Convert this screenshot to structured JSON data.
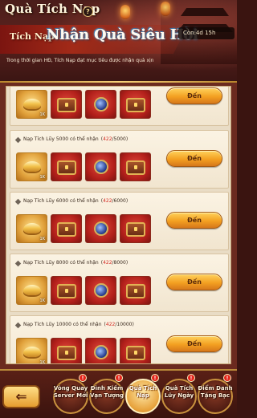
{
  "header": {
    "title": "Quà Tích Nạp",
    "help_icon": "?",
    "banner_sub": "Tích Nạp",
    "banner_main": "Nhận Quà Siêu Hời",
    "countdown": "Còn:4d 15h",
    "description": "Trong thời gian HĐ, Tích Nạp đạt mục tiêu được nhận quà xịn"
  },
  "tiers": [
    {
      "label": "",
      "current": "",
      "target": "",
      "button": "Đến",
      "rewards": [
        {
          "icon": "gold-ingot",
          "qty": "1K"
        },
        {
          "icon": "treasure-chest",
          "qty": ""
        },
        {
          "icon": "blue-orb",
          "qty": ""
        },
        {
          "icon": "treasure-chest",
          "qty": ""
        }
      ]
    },
    {
      "label": "Nạp Tích Lũy 5000 có thể nhận",
      "current": "422",
      "target": "5000",
      "button": "Đến",
      "rewards": [
        {
          "icon": "gold-ingot",
          "qty": "1K"
        },
        {
          "icon": "treasure-chest",
          "qty": ""
        },
        {
          "icon": "blue-orb",
          "qty": ""
        },
        {
          "icon": "treasure-chest",
          "qty": ""
        }
      ]
    },
    {
      "label": "Nạp Tích Lũy 6000 có thể nhận",
      "current": "422",
      "target": "6000",
      "button": "Đến",
      "rewards": [
        {
          "icon": "gold-ingot",
          "qty": "1K"
        },
        {
          "icon": "treasure-chest",
          "qty": ""
        },
        {
          "icon": "blue-orb",
          "qty": ""
        },
        {
          "icon": "treasure-chest",
          "qty": ""
        }
      ]
    },
    {
      "label": "Nạp Tích Lũy 8000 có thể nhận",
      "current": "422",
      "target": "8000",
      "button": "Đến",
      "rewards": [
        {
          "icon": "gold-ingot",
          "qty": "1K"
        },
        {
          "icon": "treasure-chest",
          "qty": ""
        },
        {
          "icon": "blue-orb",
          "qty": ""
        },
        {
          "icon": "treasure-chest",
          "qty": ""
        }
      ]
    },
    {
      "label": "Nạp Tích Lũy 10000 có thể nhận",
      "current": "422",
      "target": "10000",
      "button": "Đến",
      "rewards": [
        {
          "icon": "gold-ingot",
          "qty": "1K"
        },
        {
          "icon": "treasure-chest",
          "qty": ""
        },
        {
          "icon": "blue-orb",
          "qty": ""
        },
        {
          "icon": "treasure-chest",
          "qty": ""
        }
      ]
    }
  ],
  "nav": {
    "back_icon": "⇐",
    "tabs": [
      {
        "label": "Vòng Quay Server Mới",
        "badge": "!",
        "active": false
      },
      {
        "label": "Đình Kiếm Vạn Tượng",
        "badge": "!",
        "active": false
      },
      {
        "label": "Quà Tích Nạp",
        "badge": "!",
        "active": true
      },
      {
        "label": "Quà Tích Lũy Ngày",
        "badge": "!",
        "active": false
      },
      {
        "label": "Điểm Danh Tặng Bạc",
        "badge": "!",
        "active": false
      }
    ]
  },
  "colors": {
    "accent_gold": "#f3a021",
    "progress_red": "#d22c23",
    "frame": "#6b2a1f"
  }
}
